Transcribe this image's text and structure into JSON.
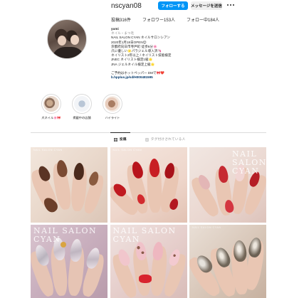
{
  "profile": {
    "username": "nscyan08",
    "follow_label": "フォローする",
    "message_label": "メッセージを送信",
    "suggest_label": "▾",
    "stats": {
      "posts": "投稿316件",
      "followers": "フォロワー153人",
      "following": "フォロー中184人"
    },
    "bio": {
      "name": "yumi",
      "category": "ネイル・まつ毛",
      "lines": [
        "NAIL SALON CYAN ネイルサロンシアン",
        "2020年1月18日OPEN😊",
        "京都府向日市寺戸町 徒歩6分🌸",
        "爪に優しい🌟パラジェル導入済🦄",
        "ネイリスト2年以上 / ネイリスト技能検定",
        "JNEC ネイリスト検定1級🌟",
        "JNA ジェルネイル検定上級🌟",
        "",
        "ご予約はホットペッパー DMで🎀❤️"
      ],
      "link": "b.hpplus.jp/sd/H000481595"
    }
  },
  "highlights": [
    {
      "label": "爪ネイル🌸🎀"
    },
    {
      "label": "掲載中の店舗"
    },
    {
      "label": "ハイライト"
    }
  ],
  "tabs": [
    {
      "label": "投稿",
      "active": true
    },
    {
      "label": "タグ付けされている人",
      "active": false
    }
  ],
  "posts": [
    {
      "watermark": "NAIL SALON CYAN",
      "style": "brown"
    },
    {
      "watermark": "NAIL SALON CYAN",
      "style": "red"
    },
    {
      "watermark": "NAIL SALON CYAN",
      "style": "pink-red"
    },
    {
      "watermark": "NAIL SALON CYAN",
      "style": "silver"
    },
    {
      "watermark": "NAIL SALON CYAN",
      "style": "pink"
    },
    {
      "watermark": "NAIL SALON CYAN",
      "style": "magnet"
    }
  ],
  "colors": {
    "accent": "#0095f6",
    "link": "#00376b",
    "muted": "#8e8e8e"
  }
}
